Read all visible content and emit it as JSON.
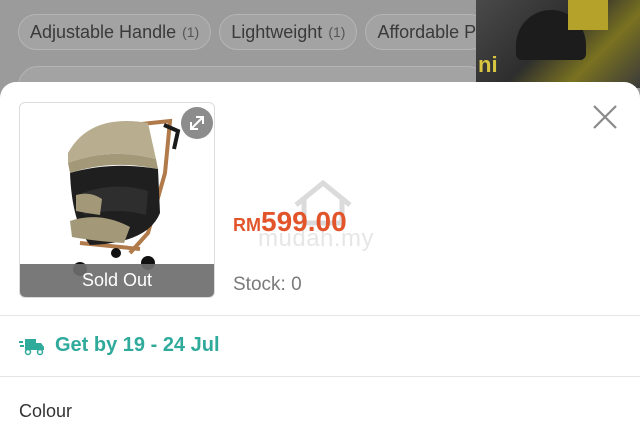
{
  "background": {
    "filter_chips": [
      {
        "label": "Adjustable Handle",
        "count": "(1)"
      },
      {
        "label": "Lightweight",
        "count": "(1)"
      },
      {
        "label": "Affordable P",
        "count": ""
      }
    ],
    "thumb_text": "ni"
  },
  "sheet": {
    "product_image_overlay": "Sold Out",
    "price_currency": "RM",
    "price_amount": "599.00",
    "watermark": "mudah.my",
    "stock": "Stock: 0",
    "delivery": "Get by 19 - 24 Jul",
    "colour_label": "Colour"
  },
  "colors": {
    "price": "#e2552b",
    "delivery": "#2faa9b",
    "overlay_dim": "#9b9b9b"
  },
  "icons": {
    "close": "close-icon",
    "expand": "expand-icon",
    "delivery": "delivery-truck-icon"
  }
}
